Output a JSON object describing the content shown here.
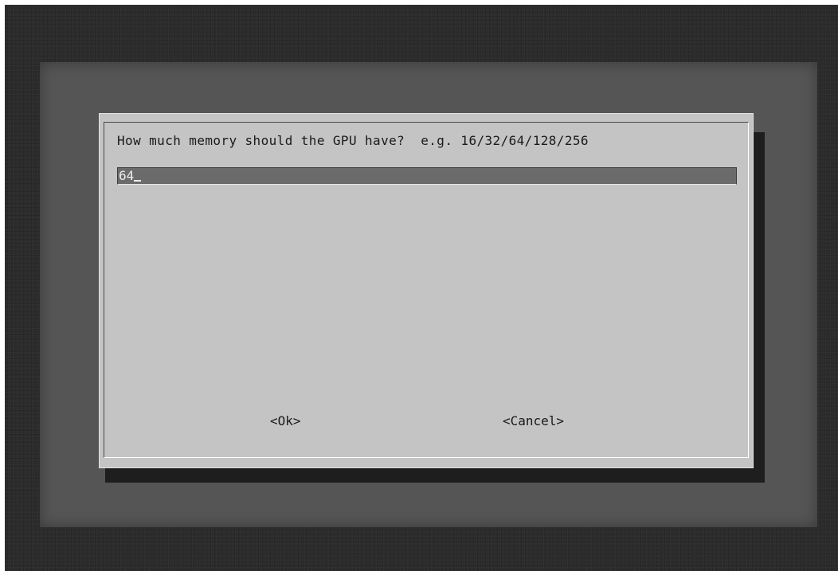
{
  "dialog": {
    "prompt": "How much memory should the GPU have?  e.g. 16/32/64/128/256",
    "input_value": "64"
  },
  "buttons": {
    "ok_label": "<Ok>",
    "cancel_label": "<Cancel>"
  }
}
